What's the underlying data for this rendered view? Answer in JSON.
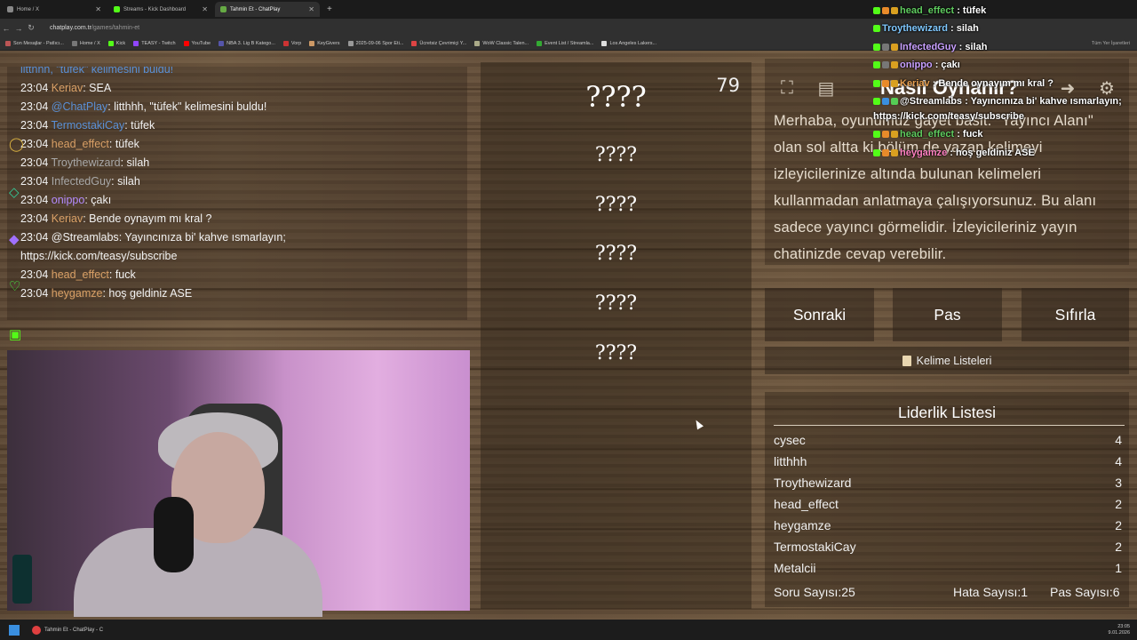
{
  "browser": {
    "tabs": [
      {
        "label": "Home / X",
        "active": false
      },
      {
        "label": "Streams - Kick Dashboard",
        "active": false
      },
      {
        "label": "Tahmin Et - ChatPlay",
        "active": true
      }
    ],
    "new_tab": "+",
    "url_host": "chatplay.com.tr",
    "url_path": "/games/tahmin-et",
    "bookmarks": [
      "Son Mesajlar - Patlıcı...",
      "Home / X",
      "Kick",
      "TEASY - Twitch",
      "YouTube",
      "NBA 3. Lig B Katego...",
      "Vorp",
      "KeyGivers",
      "2025-09-06 Spor Eti...",
      "Ücretsiz Çevrimiçi Y...",
      "WoW Classic Talen...",
      "Event List / Streamla...",
      "Los Angeles Lakers..."
    ],
    "bookmarks_right": "Tüm Yer İşaretleri"
  },
  "chat": {
    "messages": [
      {
        "time": "",
        "user": "litthhh, \"tüfek\" kelimesini buldu!",
        "color": "u-bl",
        "text": ""
      },
      {
        "time": "23:04",
        "user": "Keriav",
        "color": "u-or",
        "text": ": SEA"
      },
      {
        "time": "23:04",
        "user": "@ChatPlay",
        "color": "u-bl",
        "text": ": litthhh, \"tüfek\" kelimesini buldu!"
      },
      {
        "time": "23:04",
        "user": "TermostakiCay",
        "color": "u-bl",
        "text": ": tüfek"
      },
      {
        "time": "23:04",
        "user": "head_effect",
        "color": "u-or",
        "text": ": tüfek"
      },
      {
        "time": "23:04",
        "user": "Troythewizard",
        "color": "u-gy",
        "text": ": silah"
      },
      {
        "time": "23:04",
        "user": "InfectedGuy",
        "color": "u-gy",
        "text": ": silah"
      },
      {
        "time": "23:04",
        "user": "onippo",
        "color": "u-pu",
        "text": ": çakı"
      },
      {
        "time": "23:04",
        "user": "Keriav",
        "color": "u-or",
        "text": ": Bende oynayım mı kral ?"
      },
      {
        "time": "23:04",
        "user": "@Streamlabs",
        "color": "u-gy",
        "text": ": Yayıncınıza bi' kahve ısmarlayın;"
      },
      {
        "time": "",
        "user": "",
        "color": "u-gy",
        "text": "https://kick.com/teasy/subscribe"
      },
      {
        "time": "23:04",
        "user": "head_effect",
        "color": "u-or",
        "text": ": fuck"
      },
      {
        "time": "23:04",
        "user": "heygamze",
        "color": "u-or",
        "text": ": hoş geldiniz ASE"
      }
    ]
  },
  "game": {
    "timer": "79",
    "hidden_words": [
      "????",
      "????",
      "????",
      "????",
      "????",
      "????"
    ],
    "rules_title": "Nasıl Oynanır?",
    "rules_text": "Merhaba, oyunumuz gayet basit. \"Yayıncı Alanı\" olan sol altta ki bölüm de yazan kelimeyi izleyicilerinize altında bulunan kelimeleri kullanmadan anlatmaya çalışıyorsunuz. Bu alanı sadece yayıncı görmelidir. İzleyicileriniz yayın chatinizde cevap verebilir.",
    "buttons": {
      "next": "Sonraki",
      "pass": "Pas",
      "reset": "Sıfırla"
    },
    "word_lists": "Kelime Listeleri",
    "leaderboard": {
      "title": "Liderlik Listesi",
      "rows": [
        {
          "name": "cysec",
          "score": "4"
        },
        {
          "name": "litthhh",
          "score": "4"
        },
        {
          "name": "Troythewizard",
          "score": "3"
        },
        {
          "name": "head_effect",
          "score": "2"
        },
        {
          "name": "heygamze",
          "score": "2"
        },
        {
          "name": "TermostakiCay",
          "score": "2"
        },
        {
          "name": "Metalcii",
          "score": "1"
        }
      ],
      "question_count": "Soru Sayısı:25",
      "error_count": "Hata Sayısı:1",
      "pass_count": "Pas Sayısı:6"
    }
  },
  "overlay_chat": [
    {
      "user": "head_effect",
      "text": " : tüfek",
      "color": "#5fcc5f"
    },
    {
      "user": "Troythewizard",
      "text": " : silah",
      "color": "#7fc8ff"
    },
    {
      "user": "InfectedGuy",
      "text": " : silah",
      "color": "#c8a0ff"
    },
    {
      "user": "onippo",
      "text": " : çakı",
      "color": "#c8a0ff"
    },
    {
      "user": "Keriav",
      "text": " : Bende oynayım mı kral ?",
      "color": "#e8a050"
    },
    {
      "user": "@Streamlabs",
      "text": " : Yayıncınıza bi' kahve ısmarlayın;",
      "color": "#fff"
    },
    {
      "user": "",
      "text": "https://kick.com/teasy/subscribe",
      "color": "#fff"
    },
    {
      "user": "head_effect",
      "text": " : fuck",
      "color": "#5fcc5f"
    },
    {
      "user": "heygamze",
      "text": " : hoş geldiniz ASE",
      "color": "#ff80c0"
    }
  ],
  "taskbar": {
    "app_label": "Tahmin Et - ChatPlay - C",
    "time": "23:05",
    "date": "9.01.2026"
  }
}
